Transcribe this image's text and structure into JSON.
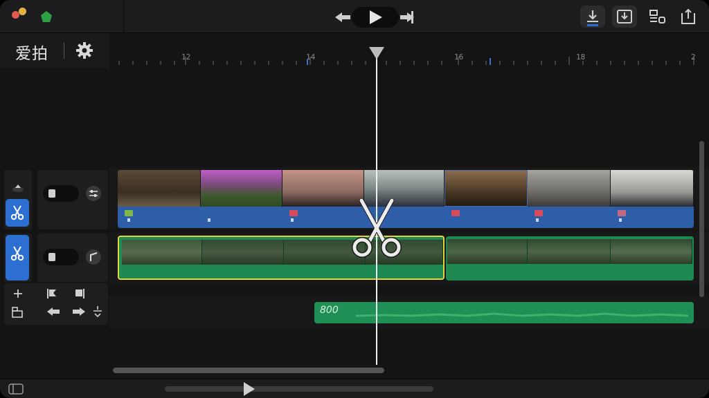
{
  "app": {
    "brand": "爱拍",
    "colors": {
      "accent": "#2d6fd0",
      "video_track": "#2f5ea8",
      "green_track": "#1e8a52",
      "selection": "#e7d63a"
    }
  },
  "toolbar": {
    "transport_icons": [
      "step-back-icon",
      "play-icon",
      "step-forward-icon"
    ],
    "right_icons": [
      "import-icon",
      "export-frame-icon",
      "layout-icon",
      "share-icon"
    ]
  },
  "left_panel": {
    "settings_icon": "gear-icon",
    "tracks": [
      {
        "name": "video-track",
        "tool": "scissors-icon",
        "toggle_icon": "toggle-icon",
        "extra_icon": "mixer-icon"
      },
      {
        "name": "green-track",
        "tool": "scissors-icon",
        "toggle_icon": "toggle-icon",
        "extra_icon": "curve-icon"
      }
    ],
    "bottom_tools": [
      "add-icon",
      "flag-in-icon",
      "flag-out-icon",
      "stack-icon",
      "arrow-left-icon",
      "arrow-right-icon",
      "split-icon"
    ]
  },
  "timeline": {
    "ruler_labels": [
      "12",
      "14",
      "16",
      "18",
      "2"
    ],
    "audio_clip_label": "800"
  }
}
